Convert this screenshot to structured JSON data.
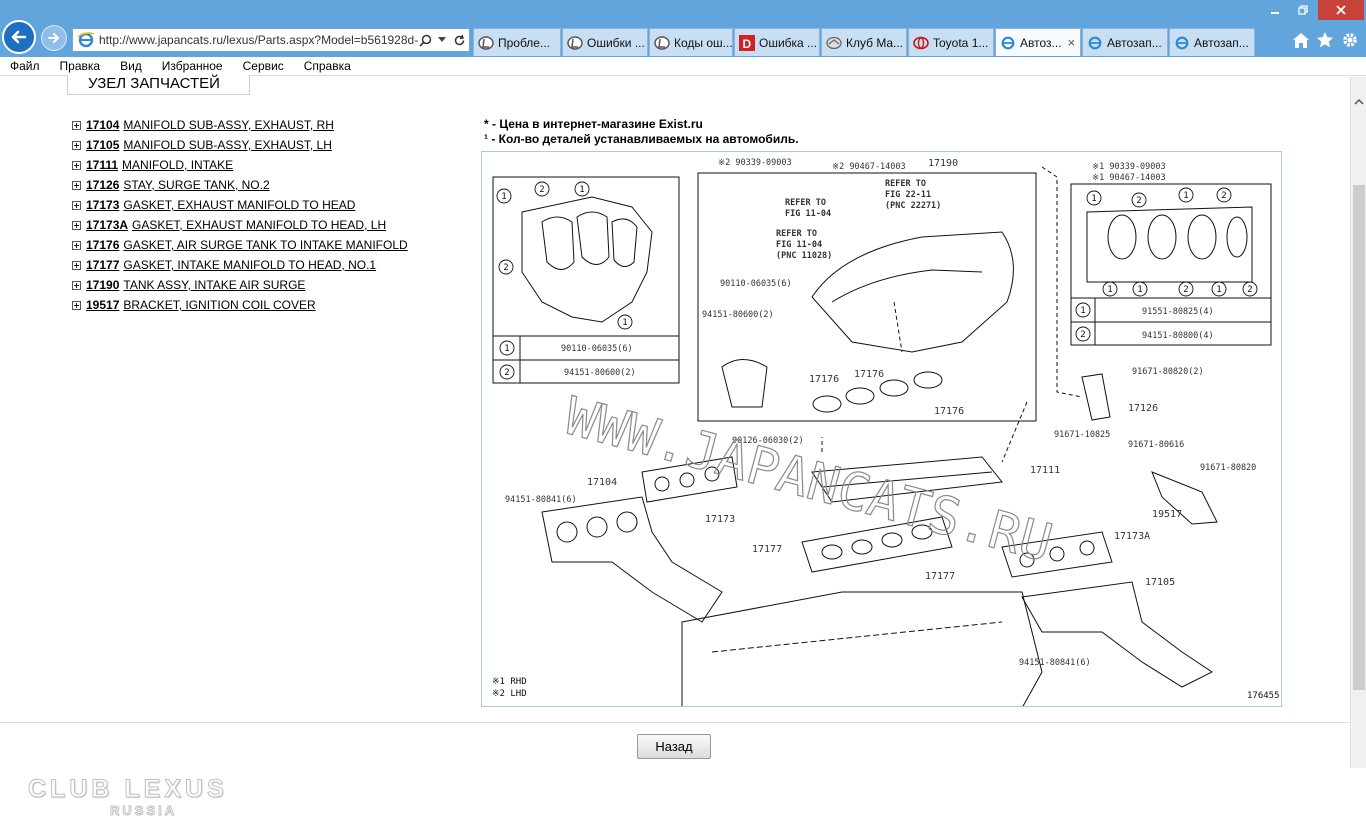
{
  "browser": {
    "address_url": "http://www.japancats.ru/lexus/Parts.aspx?Model=b561928d-",
    "tabs": [
      {
        "label": "Пробле...",
        "active": false,
        "icon": "lexus-icon"
      },
      {
        "label": "Ошибки ...",
        "active": false,
        "icon": "lexus-icon"
      },
      {
        "label": "Коды ош...",
        "active": false,
        "icon": "lexus-icon"
      },
      {
        "label": "Ошибка ...",
        "active": false,
        "icon": "d-icon"
      },
      {
        "label": "Клуб Ma...",
        "active": false,
        "icon": "mazda-icon"
      },
      {
        "label": "Toyota 1...",
        "active": false,
        "icon": "toyota-icon"
      },
      {
        "label": "Автоз...",
        "active": true,
        "icon": "ie-icon"
      },
      {
        "label": "Автозап...",
        "active": false,
        "icon": "ie-icon"
      },
      {
        "label": "Автозап...",
        "active": false,
        "icon": "ie-icon"
      }
    ],
    "close_tab_glyph": "×"
  },
  "menu": [
    "Файл",
    "Правка",
    "Вид",
    "Избранное",
    "Сервис",
    "Справка"
  ],
  "page": {
    "section_title": "УЗЕЛ ЗАПЧАСТЕЙ",
    "parts": [
      {
        "code": "17104",
        "name": "MANIFOLD SUB-ASSY, EXHAUST, RH"
      },
      {
        "code": "17105",
        "name": "MANIFOLD SUB-ASSY, EXHAUST, LH"
      },
      {
        "code": "17111",
        "name": "MANIFOLD, INTAKE"
      },
      {
        "code": "17126",
        "name": "STAY, SURGE TANK, NO.2"
      },
      {
        "code": "17173",
        "name": "GASKET, EXHAUST MANIFOLD TO HEAD"
      },
      {
        "code": "17173A",
        "name": "GASKET, EXHAUST MANIFOLD TO HEAD, LH"
      },
      {
        "code": "17176",
        "name": "GASKET, AIR SURGE TANK TO INTAKE MANIFOLD"
      },
      {
        "code": "17177",
        "name": "GASKET, INTAKE MANIFOLD TO HEAD, NO.1"
      },
      {
        "code": "17190",
        "name": "TANK ASSY, INTAKE AIR SURGE"
      },
      {
        "code": "19517",
        "name": "BRACKET, IGNITION COIL COVER"
      }
    ],
    "notes": [
      "* - Цена в интернет-магазине Exist.ru",
      "¹ - Кол-во деталей устанавливаемых на автомобиль."
    ],
    "back_button": "Назад"
  },
  "diagram": {
    "watermark": "WWW.JAPANCATS.RU",
    "figure_number": "176455",
    "legend": [
      "※1 RHD",
      "※2 LHD"
    ],
    "left_inset": {
      "row1": {
        "num": "1",
        "part": "90110-06035(6)"
      },
      "row2": {
        "num": "2",
        "part": "94151-80600(2)"
      },
      "callouts": [
        "1",
        "2",
        "1",
        "2",
        "1"
      ]
    },
    "right_inset": {
      "row1": {
        "num": "1",
        "part": "91551-80825(4)"
      },
      "row2": {
        "num": "2",
        "part": "94151-80800(4)"
      },
      "callouts": [
        "1",
        "2",
        "1",
        "2",
        "1",
        "1",
        "2",
        "1",
        "2"
      ]
    },
    "top_labels": {
      "ref_a1": "※2 90339-09003",
      "ref_a2": "※2 90467-14003",
      "tank": "17190",
      "ref_b1": "※1 90339-09003",
      "ref_b2": "※1 90467-14003",
      "refer1_a": "REFER TO",
      "refer1_b": "FIG 22-11",
      "refer1_c": "(PNC 22271)",
      "refer2_a": "REFER TO",
      "refer2_b": "FIG 11-04",
      "refer3_a": "REFER TO",
      "refer3_b": "FIG 11-04",
      "refer3_c": "(PNC 11028)",
      "bolt1": "90110-06035(6)",
      "nut1": "94151-80600(2)",
      "g1": "17176",
      "g2": "17176",
      "g3": "17176"
    },
    "labels": {
      "bolt_intake": "90126-06030(2)",
      "bolt_stay": "91671-10825",
      "manifold": "17111",
      "stay_bolt": "91671-80820(2)",
      "stay": "17126",
      "bracket_bolt1": "91671-80616",
      "bracket_bolt2": "91671-80820",
      "bracket": "19517",
      "exh_rh": "17104",
      "nut_rh": "94151-80841(6)",
      "gasket_rh": "17173",
      "gasket_intake_a": "17177",
      "gasket_intake_b": "17177",
      "gasket_lh": "17173A",
      "exh_lh": "17105",
      "nut_lh": "94151-80841(6)"
    }
  },
  "branding": {
    "line1": "CLUB LEXUS",
    "line2": "RUSSIA"
  },
  "colors": {
    "titlebar": "#62a4dc",
    "tab_active": "#f7fbff",
    "close": "#c7423a"
  }
}
